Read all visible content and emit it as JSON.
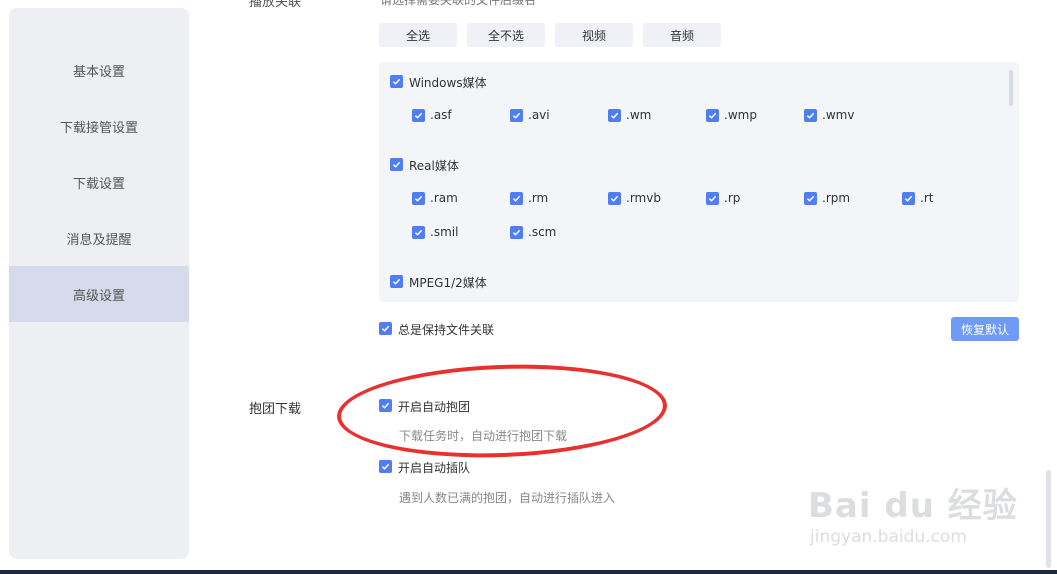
{
  "sidebar": {
    "items": [
      {
        "label": "基本设置"
      },
      {
        "label": "下载接管设置"
      },
      {
        "label": "下载设置"
      },
      {
        "label": "消息及提醒"
      },
      {
        "label": "高级设置"
      }
    ]
  },
  "top": {
    "section_label_cropped": "播放关联",
    "hint_cropped": "请选择需要关联的文件后缀名"
  },
  "filter_buttons": [
    "全选",
    "全不选",
    "视频",
    "音频"
  ],
  "file_groups": [
    {
      "name": "Windows媒体",
      "checked": true,
      "exts": [
        ".asf",
        ".avi",
        ".wm",
        ".wmp",
        ".wmv"
      ]
    },
    {
      "name": "Real媒体",
      "checked": true,
      "exts": [
        ".ram",
        ".rm",
        ".rmvb",
        ".rp",
        ".rpm",
        ".rt",
        ".smil",
        ".scm"
      ]
    },
    {
      "name": "MPEG1/2媒体",
      "checked": true,
      "exts": []
    }
  ],
  "always_keep": {
    "label": "总是保持文件关联",
    "checked": true
  },
  "restore_button": "恢复默认",
  "group_download": {
    "section_label": "抱团下载",
    "auto_group": {
      "label": "开启自动抱团",
      "checked": true,
      "hint": "下载任务时，自动进行抱团下载"
    },
    "auto_queue": {
      "label": "开启自动插队",
      "checked": true,
      "hint": "遇到人数已满的抱团，自动进行插队进入"
    }
  },
  "watermark": {
    "main": "Bai du 经验",
    "sub": "jingyan.baidu.com"
  },
  "colors": {
    "accent": "#4f7df3",
    "annotation": "#e8302f",
    "restore_button": "#6f9af6"
  }
}
